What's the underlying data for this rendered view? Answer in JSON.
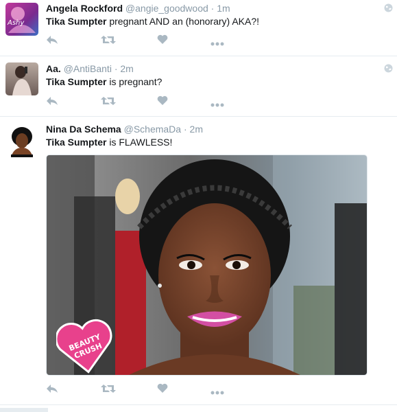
{
  "tweets": [
    {
      "name": "Angela Rockford",
      "handle": "@angie_goodwood",
      "time": "1m",
      "avatar_label": "Ashy",
      "text_bold": "Tika Sumpter",
      "text_rest": " pregnant AND an (honorary) AKA?!"
    },
    {
      "name": "Aa.",
      "handle": "@AntiBanti",
      "time": "2m",
      "text_bold": "Tika Sumpter",
      "text_rest": " is pregnant?"
    },
    {
      "name": "Nina Da Schema",
      "handle": "@SchemaDa",
      "time": "2m",
      "text_bold": "Tika Sumpter",
      "text_rest": " is FLAWLESS!",
      "media_badge": [
        "BEAUTY",
        "CRUSH"
      ]
    }
  ],
  "separator": "·",
  "icons": [
    "reply-icon",
    "retweet-icon",
    "like-icon",
    "more-icon",
    "globe-icon"
  ],
  "colors": {
    "icon": "#aab8c2",
    "muted": "#8899a6",
    "text": "#14171a",
    "badge": "#e8418c"
  }
}
